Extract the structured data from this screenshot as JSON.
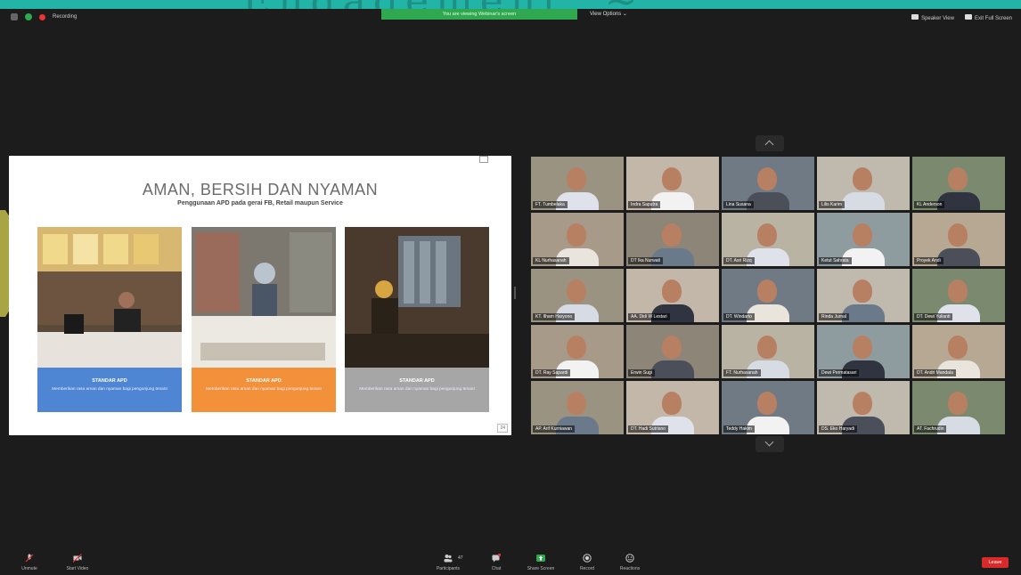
{
  "topbar": {
    "recording_label": "Recording",
    "share_banner": "You are viewing Webinar's screen",
    "view_options": "View Options ⌄",
    "speaker_view": "Speaker View",
    "exit_full_screen": "Exit Full Screen"
  },
  "slide": {
    "title": "AMAN, BERSIH DAN NYAMAN",
    "subtitle": "Penggunaan APD pada gerai FB, Retail maupun Service",
    "page": "24",
    "panels": [
      {
        "title": "STANDAR APD",
        "desc": "Memberikan rasa aman dan nyaman bagi pengunjung tenant",
        "color": "#4e86d4"
      },
      {
        "title": "STANDAR APD",
        "desc": "Memberikan rasa aman dan nyaman bagi pengunjung tenant",
        "color": "#f3903a"
      },
      {
        "title": "STANDAR APD",
        "desc": "Memberikan rasa aman dan nyaman bagi pengunjung tenant",
        "color": "#a6a6a6"
      }
    ]
  },
  "gallery": {
    "participants": [
      "FT. Tumbelaka",
      "Indra Saputra",
      "Lina Susana",
      "Lilis Karim",
      "KL Anderson",
      "KL Nurhasanah",
      "DT Ika Nurwati",
      "DT. Asri Rizq",
      "Ketut Sahrata",
      "Proyek Andi",
      "KT. Ilham Haryono",
      "AA. Didi W Lestari",
      "DT. Windarto",
      "Rinda Jurnal",
      "DT. Dewi Yulianti",
      "DT. Ray Sapardi",
      "Erwin Sugi",
      "FT. Nurhasanah",
      "Dewi Permatasari",
      "DT. Andri Mandala",
      "AP. Arif Kurniawan",
      "DT. Hadi Sutrisno",
      "Teddy Hakim",
      "DS. Eko Haryadi",
      "AT. Fachrudin"
    ]
  },
  "toolbar": {
    "unmute": "Unmute",
    "start_video": "Start Video",
    "participants": "Participants",
    "participants_count": "47",
    "chat": "Chat",
    "share": "Share Screen",
    "record": "Record",
    "reactions": "Reactions",
    "leave": "Leave"
  },
  "colors": {
    "share_green": "#2fa84f",
    "leave_red": "#d72b2b",
    "arrow_olive": "#a9a544"
  }
}
